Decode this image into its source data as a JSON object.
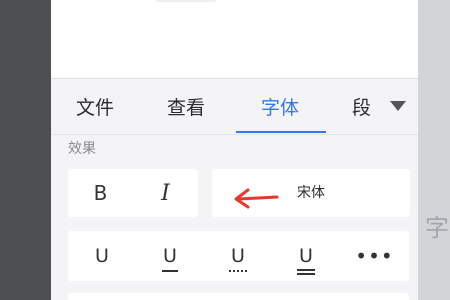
{
  "tabs": [
    {
      "label": "文件"
    },
    {
      "label": "查看"
    },
    {
      "label": "字体"
    },
    {
      "label": "段"
    }
  ],
  "active_tab": "字体",
  "accent_color": "#3578e5",
  "section_label": "效果",
  "formatting": {
    "bold_label": "B",
    "italic_label": "I",
    "font_name": "宋体"
  },
  "underline_row": [
    {
      "icon": "underline-single-icon",
      "label": "U"
    },
    {
      "icon": "underline-double-icon",
      "label": "U"
    },
    {
      "icon": "underline-dotted-icon",
      "label": "U"
    },
    {
      "icon": "underline-thick-icon",
      "label": "U"
    }
  ],
  "more_label": "•••",
  "annotation": {
    "icon": "red-arrow-icon",
    "color": "#e03a2f"
  },
  "background_ghost_text": "字"
}
